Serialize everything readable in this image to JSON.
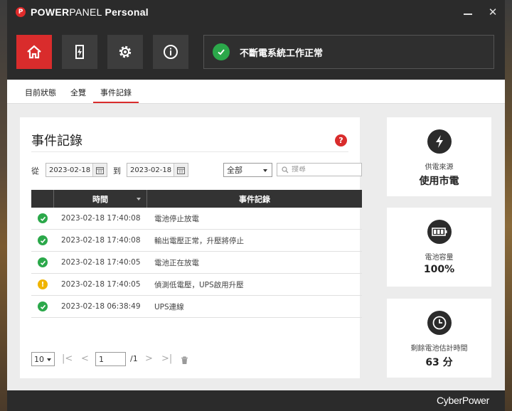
{
  "app": {
    "brand_name_1": "POWER",
    "brand_name_2": "PANEL",
    "edition": "Personal",
    "minimize_icon": "minimize-icon",
    "close_label": "✕"
  },
  "nav": [
    {
      "name": "home",
      "icon": "home-icon",
      "active": true
    },
    {
      "name": "power",
      "icon": "power-flash-icon",
      "active": false
    },
    {
      "name": "settings",
      "icon": "gear-icon",
      "active": false
    },
    {
      "name": "info",
      "icon": "info-icon",
      "active": false
    }
  ],
  "status": {
    "text": "不斷電系統工作正常",
    "icon": "check-icon"
  },
  "tabs": [
    {
      "label": "目前狀態",
      "active": false
    },
    {
      "label": "全覽",
      "active": false
    },
    {
      "label": "事件記錄",
      "active": true
    }
  ],
  "panel": {
    "title": "事件記錄",
    "help_label": "?",
    "filter": {
      "from_label": "從",
      "from_date": "2023-02-18",
      "to_label": "到",
      "to_date": "2023-02-18",
      "category_selected": "全部",
      "search_placeholder": "搜尋"
    },
    "table": {
      "headers": [
        "",
        "時間",
        "事件記錄"
      ],
      "rows": [
        {
          "status": "ok",
          "time": "2023-02-18 17:40:08",
          "event": "電池停止放電"
        },
        {
          "status": "ok",
          "time": "2023-02-18 17:40:08",
          "event": "輸出電壓正常，升壓將停止"
        },
        {
          "status": "ok",
          "time": "2023-02-18 17:40:05",
          "event": "電池正在放電"
        },
        {
          "status": "warn",
          "time": "2023-02-18 17:40:05",
          "event": "偵測低電壓，UPS啟用升壓"
        },
        {
          "status": "ok",
          "time": "2023-02-18 06:38:49",
          "event": "UPS連線"
        }
      ]
    },
    "pager": {
      "page_size": "10",
      "current_page": "1",
      "total": "/1",
      "first": "|<",
      "prev": "<",
      "next": ">",
      "last": ">|"
    }
  },
  "cards": [
    {
      "label": "供電來源",
      "value": "使用市電",
      "icon": "lightning-icon"
    },
    {
      "label": "電池容量",
      "value": "100%",
      "icon": "battery-icon"
    },
    {
      "label": "剩餘電池估計時間",
      "value": "63 分",
      "icon": "clock-icon"
    }
  ],
  "footer": {
    "brand": "CyberPower"
  },
  "colors": {
    "accent": "#d92c2c",
    "ok": "#2ba84a",
    "warn": "#f0b400",
    "dark": "#2b2b2b"
  }
}
